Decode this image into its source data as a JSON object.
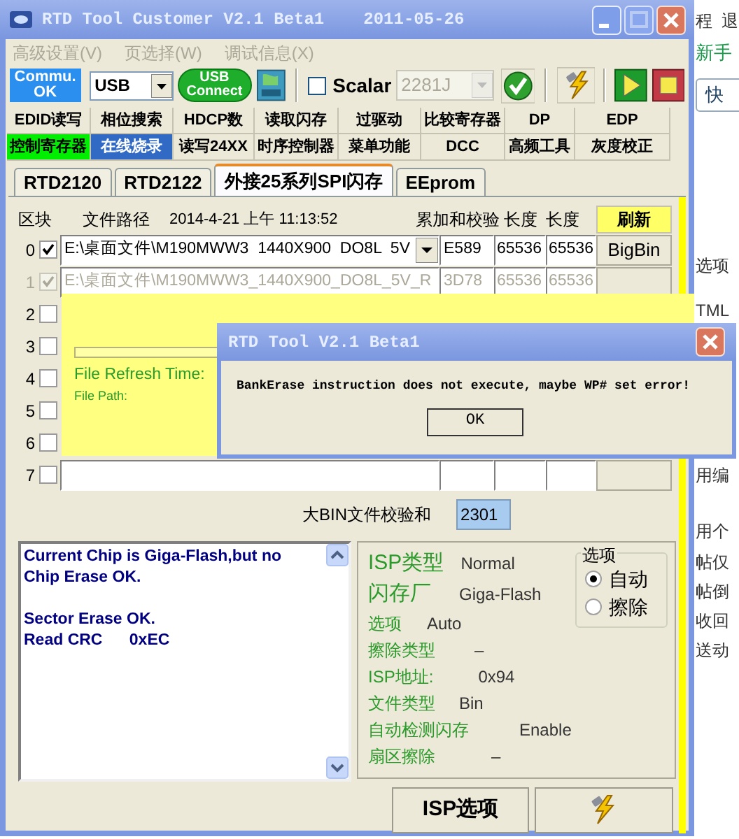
{
  "window": {
    "title": "RTD Tool Customer V2.1 Beta1",
    "date": "2011-05-26"
  },
  "menu": [
    {
      "label": "高级设置(V)",
      "disabled": true
    },
    {
      "label": "页选择(W)",
      "disabled": true
    },
    {
      "label": "调试信息(X)",
      "disabled": true
    }
  ],
  "toolbar": {
    "status_button": "Commu. OK",
    "port": {
      "value": "USB"
    },
    "connect_button": "USB Connect",
    "scalar": {
      "label": "Scalar",
      "checked": false
    },
    "scalar_select": {
      "value": "2281J",
      "disabled": true
    }
  },
  "function_tabs": [
    {
      "label": "EDID读写",
      "selected": false,
      "highlighted": false
    },
    {
      "label": "相位搜索",
      "selected": false,
      "highlighted": false
    },
    {
      "label": "HDCP数",
      "selected": false,
      "highlighted": false
    },
    {
      "label": "读取闪存",
      "selected": false,
      "highlighted": false
    },
    {
      "label": "过驱动",
      "selected": false,
      "highlighted": false
    },
    {
      "label": "比较寄存器",
      "selected": false,
      "highlighted": false
    },
    {
      "label": "DP",
      "selected": false,
      "highlighted": false
    },
    {
      "label": "EDP",
      "selected": false,
      "highlighted": false
    },
    {
      "label": "控制寄存器",
      "selected": false,
      "highlighted": true
    },
    {
      "label": "在线烧录",
      "selected": true,
      "highlighted": false
    },
    {
      "label": "读写24XX",
      "selected": false,
      "highlighted": false
    },
    {
      "label": "时序控制器",
      "selected": false,
      "highlighted": false
    },
    {
      "label": "菜单功能",
      "selected": false,
      "highlighted": false
    },
    {
      "label": "DCC",
      "selected": false,
      "highlighted": false
    },
    {
      "label": "高频工具",
      "selected": false,
      "highlighted": false
    },
    {
      "label": "灰度校正",
      "selected": false,
      "highlighted": false
    }
  ],
  "device_tabs": [
    {
      "label": "RTD2120",
      "selected": false
    },
    {
      "label": "RTD2122",
      "selected": false
    },
    {
      "label": "外接25系列SPI闪存",
      "selected": true
    },
    {
      "label": "EEprom",
      "selected": false
    }
  ],
  "table": {
    "columns": [
      "区块",
      "文件路径",
      "2014-4-21 上午 11:13:52",
      "累加和校验",
      "长度",
      "长度"
    ],
    "refresh_button": "刷新",
    "rows": [
      {
        "index": "0",
        "checked": true,
        "disabled": false,
        "dropdown": true,
        "path": "E:\\桌面文件\\M190MWW3  1440X900  DO8L  5V",
        "checksum": "E589",
        "length_1": "65536",
        "length_2": "65536",
        "button": "BigBin"
      },
      {
        "index": "1",
        "checked": true,
        "disabled": true,
        "dropdown": false,
        "path": "E:\\桌面文件\\M190MWW3_1440X900_DO8L_5V_R",
        "checksum": "3D78",
        "length_1": "65536",
        "length_2": "65536"
      },
      {
        "index": "2",
        "checked": false,
        "disabled": false
      },
      {
        "index": "3",
        "checked": false,
        "disabled": false
      },
      {
        "index": "4",
        "checked": false,
        "disabled": false
      },
      {
        "index": "5",
        "checked": false,
        "disabled": false
      },
      {
        "index": "6",
        "checked": false,
        "disabled": false
      },
      {
        "index": "7",
        "checked": false,
        "disabled": false,
        "dropdown": false
      }
    ]
  },
  "refresh_panel": {
    "progress": {
      "level": 0
    },
    "refresh_time_label": "File Refresh Time:",
    "file_path_label": "File Path:"
  },
  "bin_checksum": {
    "label": "大BIN文件校验和",
    "value": "2301"
  },
  "log": {
    "paragraphs": [
      [
        "Current Chip is Giga-Flash,but no",
        "Chip Erase OK."
      ],
      [
        "Sector Erase OK.",
        "Read CRC      0xEC"
      ]
    ]
  },
  "isp_info": [
    {
      "label": "ISP类型",
      "value": "Normal"
    },
    {
      "label": "闪存厂",
      "value": "Giga-Flash"
    },
    {
      "label": "选项",
      "value": "Auto"
    },
    {
      "label": "擦除类型",
      "value": "–"
    },
    {
      "label": "ISP地址:",
      "value": "0x94"
    },
    {
      "label": "文件类型",
      "value": "Bin"
    },
    {
      "label": "自动检测闪存",
      "value": "Enable"
    },
    {
      "label": "扇区擦除",
      "value": "–"
    }
  ],
  "options_group": {
    "title": "选项",
    "choices": [
      {
        "label": "自动",
        "selected": true
      },
      {
        "label": "擦除",
        "selected": false
      }
    ]
  },
  "isp_options_button": "ISP选项",
  "dialog": {
    "title": "RTD Tool V2.1 Beta1",
    "message": "BankErase instruction does not execute, maybe WP# set error!",
    "button": "OK"
  },
  "background_page": [
    {
      "kind": "text",
      "text": "程  退"
    },
    {
      "kind": "link",
      "text": "新手"
    },
    {
      "kind": "button",
      "text": "快"
    },
    {
      "kind": "text",
      "text": "选项"
    },
    {
      "kind": "text",
      "text": "TML"
    },
    {
      "kind": "text",
      "text": "用编"
    },
    {
      "kind": "text",
      "text": "用个"
    },
    {
      "kind": "text",
      "text": "帖仅"
    },
    {
      "kind": "text",
      "text": "帖倒"
    },
    {
      "kind": "text",
      "text": "收回"
    },
    {
      "kind": "text",
      "text": "送动"
    }
  ]
}
